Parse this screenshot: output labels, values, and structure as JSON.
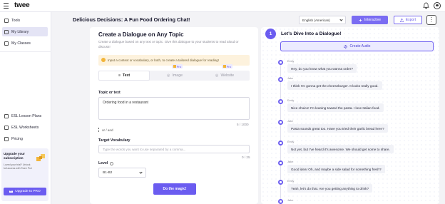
{
  "app": {
    "logo": "twee"
  },
  "sidebar": {
    "items": [
      {
        "label": "Tools",
        "icon": "tools-icon"
      },
      {
        "label": "My Library",
        "icon": "library-icon",
        "active": true
      },
      {
        "label": "My Classes",
        "icon": "classes-icon"
      },
      {
        "label": "ESL Lesson Plans",
        "icon": "lesson-plans-icon"
      },
      {
        "label": "ESL Worksheets",
        "icon": "worksheets-icon"
      },
      {
        "label": "Pricing",
        "icon": "pricing-icon"
      }
    ],
    "upgrade": {
      "title": "Upgrade your subscription",
      "text": "Loved your trial? Unlock full access with Twee Pro!",
      "button": "Upgrade to PRO"
    }
  },
  "header": {
    "title": "Delicious Decisions: A Fun Food Ordering Chat!",
    "language": "English (American)",
    "interactive_label": "Interactive",
    "export_label": "Export",
    "more_label": "⋮"
  },
  "form": {
    "title": "Create a Dialogue on Any Topic",
    "description": "Create a dialogue based on any text or topic. Give this dialogue to your students to read aloud or discuss!",
    "alert": "Input a context or vocabulary, or both, to create a tailored dialogue for reading!",
    "tabs": [
      {
        "label": "Text",
        "active": true
      },
      {
        "label": "Image",
        "pro": "Pro"
      },
      {
        "label": "Website",
        "pro": "Pro"
      }
    ],
    "topic_label": "Topic or text",
    "topic_value": "Ordering food in a restaurant",
    "topic_counter": "5 / 1000",
    "or_and": "or / and",
    "vocab_label": "Target Vocabulary",
    "vocab_placeholder": "Type the words you want to use separated by a comma...",
    "vocab_counter": "0 / 25",
    "level_label": "Level",
    "level_value": "B1-B2",
    "submit_label": "Do the magic!"
  },
  "dialogue": {
    "step": "1",
    "title": "Let's Dive Into a Dialogue!",
    "create_audio_label": "Create Audio",
    "messages": [
      {
        "speaker": "Emily",
        "text": "Hey, do you know what you wanna order?"
      },
      {
        "speaker": "Jake",
        "text": "I think I'm gonna get the cheeseburger. It looks really good."
      },
      {
        "speaker": "Emily",
        "text": "Nice choice! I'm leaning toward the pasta. I love Italian food."
      },
      {
        "speaker": "Jake",
        "text": "Pasta sounds great too. Have you tried their garlic bread here?"
      },
      {
        "speaker": "Emily",
        "text": "Not yet, but I've heard it's awesome. We should get some to share."
      },
      {
        "speaker": "Jake",
        "text": "Good idea! Oh, and maybe a side salad for something fresh?"
      },
      {
        "speaker": "Emily",
        "text": "Yeah, let's do that. Are you getting anything to drink?"
      },
      {
        "speaker": "Jake",
        "text": ""
      }
    ]
  },
  "colors": {
    "accent": "#6b5cf0",
    "alert_bg": "#fdf2dd"
  }
}
